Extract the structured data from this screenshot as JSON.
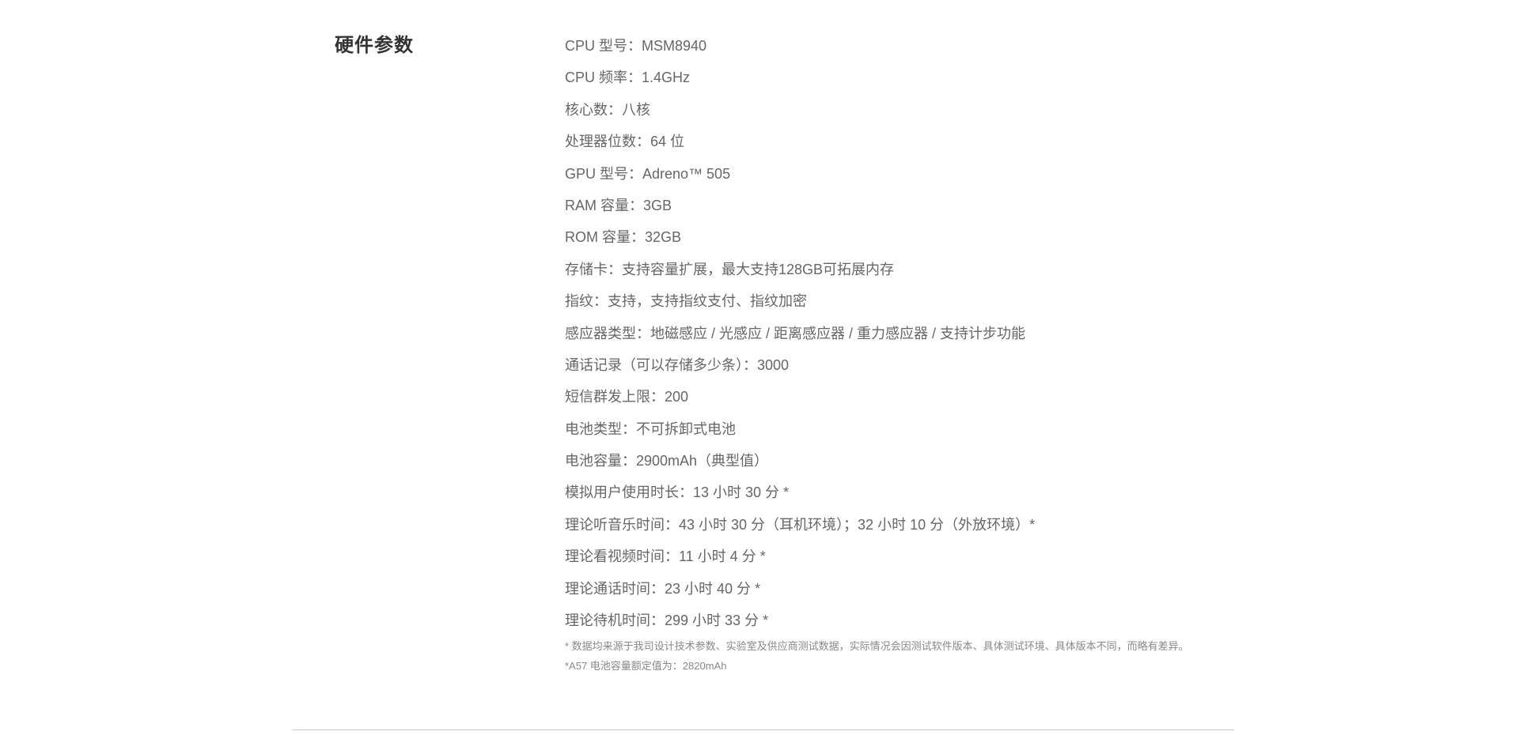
{
  "section": {
    "title": "硬件参数"
  },
  "specs": [
    {
      "text": "CPU 型号：MSM8940"
    },
    {
      "text": "CPU 频率：1.4GHz"
    },
    {
      "text": "核心数：八核"
    },
    {
      "text": "处理器位数：64 位"
    },
    {
      "text": "GPU 型号：Adreno™ 505"
    },
    {
      "text": "RAM 容量：3GB"
    },
    {
      "text": "ROM 容量：32GB"
    },
    {
      "text": "存储卡：支持容量扩展，最大支持128GB可拓展内存"
    },
    {
      "text": "指纹：支持，支持指纹支付、指纹加密"
    },
    {
      "text": "感应器类型：地磁感应 / 光感应 / 距离感应器 / 重力感应器 / 支持计步功能"
    },
    {
      "text": "通话记录（可以存储多少条）：3000"
    },
    {
      "text": "短信群发上限：200"
    },
    {
      "text": "电池类型：不可拆卸式电池"
    },
    {
      "text": "电池容量：2900mAh（典型值）"
    },
    {
      "text": "模拟用户使用时长：13 小时 30 分 *"
    },
    {
      "text": "理论听音乐时间：43 小时 30 分（耳机环境）；32 小时 10 分（外放环境）*"
    },
    {
      "text": "理论看视频时间：11 小时 4 分  *"
    },
    {
      "text": "理论通话时间：23 小时 40 分 *"
    },
    {
      "text": "理论待机时间：299 小时 33 分 *"
    }
  ],
  "notes": [
    "* 数据均来源于我司设计技术参数、实验室及供应商测试数据，实际情况会因测试软件版本、具体测试环境、具体版本不同，而略有差异。",
    "*A57 电池容量额定值为：2820mAh"
  ]
}
